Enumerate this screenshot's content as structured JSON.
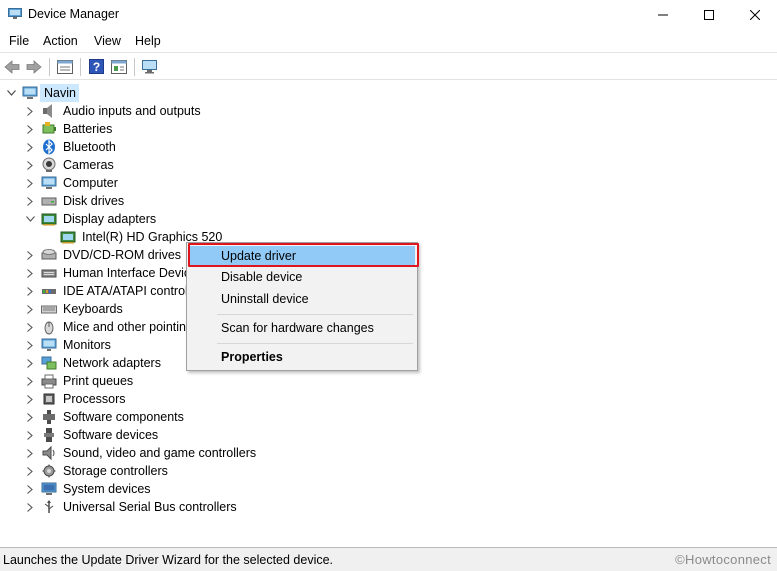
{
  "window": {
    "title": "Device Manager",
    "minimize_glyph": "—",
    "close_glyph": "✕"
  },
  "menu": {
    "items": [
      "File",
      "Action",
      "View",
      "Help"
    ]
  },
  "toolbar": {
    "icons": [
      "back-arrow-icon",
      "forward-arrow-icon",
      "properties-icon",
      "help-icon",
      "update-icon",
      "scan-monitor-icon"
    ]
  },
  "tree": {
    "root": "Navin",
    "categories": [
      {
        "label": "Audio inputs and outputs",
        "icon": "speaker-icon"
      },
      {
        "label": "Batteries",
        "icon": "battery-icon"
      },
      {
        "label": "Bluetooth",
        "icon": "bluetooth-icon"
      },
      {
        "label": "Cameras",
        "icon": "camera-icon"
      },
      {
        "label": "Computer",
        "icon": "computer-icon"
      },
      {
        "label": "Disk drives",
        "icon": "disk-drive-icon"
      },
      {
        "label": "Display adapters",
        "icon": "display-adapter-icon",
        "expanded": true
      },
      {
        "label": "Intel(R) HD Graphics 520",
        "icon": "display-adapter-icon",
        "child": true
      },
      {
        "label": "DVD/CD-ROM drives",
        "icon": "dvd-icon"
      },
      {
        "label": "Human Interface Devic",
        "icon": "hid-icon"
      },
      {
        "label": "IDE ATA/ATAPI controlle",
        "icon": "ide-icon"
      },
      {
        "label": "Keyboards",
        "icon": "keyboard-icon"
      },
      {
        "label": "Mice and other pointin",
        "icon": "mouse-icon"
      },
      {
        "label": "Monitors",
        "icon": "monitor-icon"
      },
      {
        "label": "Network adapters",
        "icon": "network-icon"
      },
      {
        "label": "Print queues",
        "icon": "printer-icon"
      },
      {
        "label": "Processors",
        "icon": "processor-icon"
      },
      {
        "label": "Software components",
        "icon": "software-component-icon"
      },
      {
        "label": "Software devices",
        "icon": "software-device-icon"
      },
      {
        "label": "Sound, video and game controllers",
        "icon": "sound-icon"
      },
      {
        "label": "Storage controllers",
        "icon": "storage-icon"
      },
      {
        "label": "System devices",
        "icon": "system-device-icon"
      },
      {
        "label": "Universal Serial Bus controllers",
        "icon": "usb-icon"
      }
    ]
  },
  "context_menu": {
    "update_driver": "Update driver",
    "disable_device": "Disable device",
    "uninstall_device": "Uninstall device",
    "scan_hardware": "Scan for hardware changes",
    "properties": "Properties"
  },
  "status": {
    "text": "Launches the Update Driver Wizard for the selected device.",
    "watermark": "©Howtoconnect"
  },
  "colors": {
    "selection": "#cce8ff",
    "menu_hover": "#91c9f7",
    "highlight_border": "#e0141e"
  }
}
